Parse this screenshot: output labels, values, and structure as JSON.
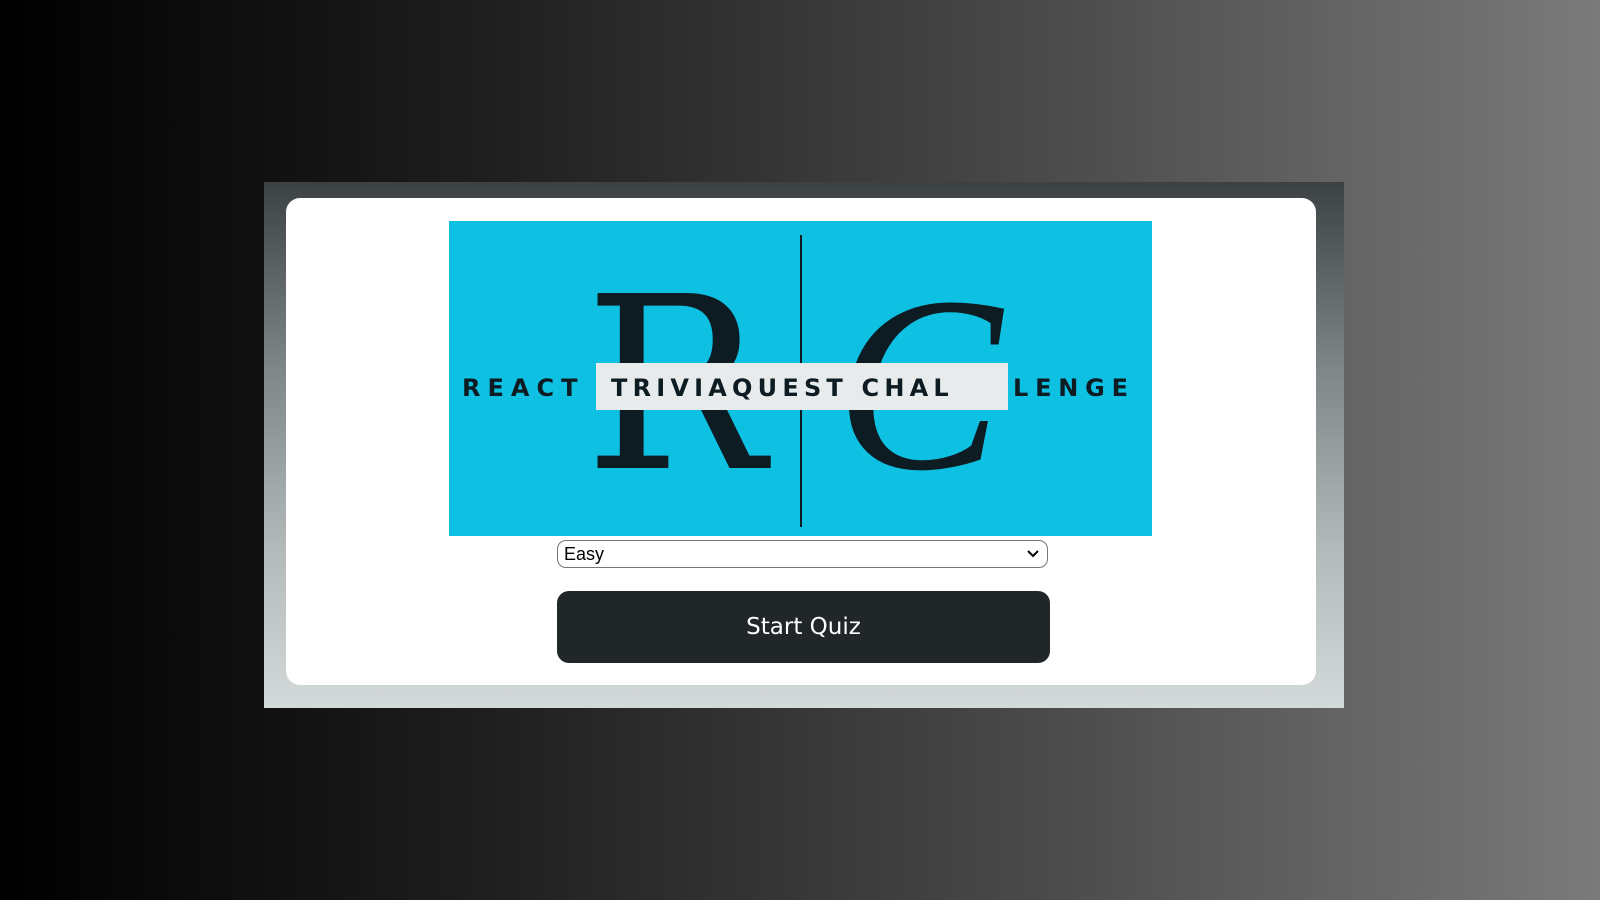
{
  "logo": {
    "initial_left": "R",
    "initial_right": "C",
    "text_left": "REACT",
    "text_highlight": "TRIVIAQUEST CHAL",
    "text_right": "LENGE",
    "background_color": "#0ec0e1"
  },
  "difficulty": {
    "selected": "Easy",
    "options": [
      "Easy"
    ]
  },
  "actions": {
    "start_label": "Start Quiz"
  },
  "colors": {
    "button_bg": "#212629",
    "card_bg": "#ffffff"
  }
}
